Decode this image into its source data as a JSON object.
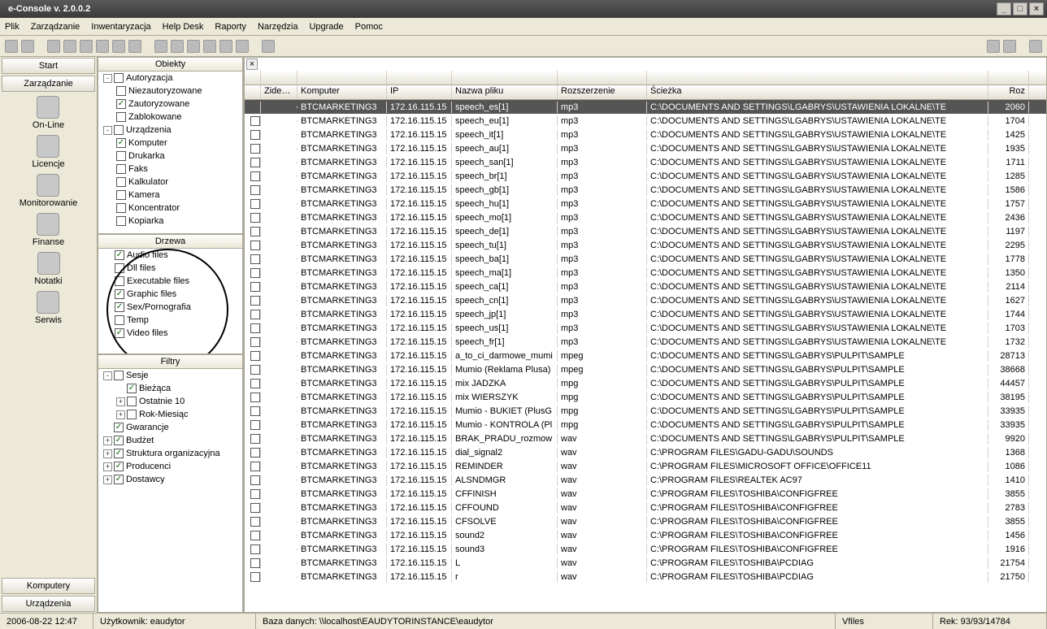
{
  "window": {
    "title": "e-Console v. 2.0.0.2"
  },
  "menu": [
    "Plik",
    "Zarządzanie",
    "Inwentaryzacja",
    "Help Desk",
    "Raporty",
    "Narzędzia",
    "Upgrade",
    "Pomoc"
  ],
  "leftnav": {
    "top_buttons": [
      "Start",
      "Zarządzanie"
    ],
    "items": [
      {
        "label": "On-Line"
      },
      {
        "label": "Licencje"
      },
      {
        "label": "Monitorowanie"
      },
      {
        "label": "Finanse"
      },
      {
        "label": "Notatki"
      },
      {
        "label": "Serwis"
      }
    ],
    "bottom_buttons": [
      "Komputery",
      "Urządzenia"
    ]
  },
  "panels": {
    "obiekty": {
      "title": "Obiekty",
      "tree": [
        {
          "indent": 0,
          "exp": "-",
          "chk": false,
          "label": "Autoryzacja"
        },
        {
          "indent": 1,
          "chk": false,
          "label": "Niezautoryzowane"
        },
        {
          "indent": 1,
          "chk": true,
          "label": "Zautoryzowane"
        },
        {
          "indent": 1,
          "chk": false,
          "label": "Zablokowane"
        },
        {
          "indent": 0,
          "exp": "-",
          "chk": false,
          "label": "Urządzenia"
        },
        {
          "indent": 1,
          "chk": true,
          "label": "Komputer"
        },
        {
          "indent": 1,
          "chk": false,
          "label": "Drukarka"
        },
        {
          "indent": 1,
          "chk": false,
          "label": "Faks"
        },
        {
          "indent": 1,
          "chk": false,
          "label": "Kalkulator"
        },
        {
          "indent": 1,
          "chk": false,
          "label": "Kamera"
        },
        {
          "indent": 1,
          "chk": false,
          "label": "Koncentrator"
        },
        {
          "indent": 1,
          "chk": false,
          "label": "Kopiarka"
        }
      ]
    },
    "drzewa": {
      "title": "Drzewa",
      "items": [
        {
          "chk": true,
          "label": "Audio files"
        },
        {
          "chk": false,
          "label": "Dll files"
        },
        {
          "chk": false,
          "label": "Executable files"
        },
        {
          "chk": true,
          "label": "Graphic files"
        },
        {
          "chk": true,
          "label": "Sex/Pornografia"
        },
        {
          "chk": false,
          "label": "Temp"
        },
        {
          "chk": true,
          "label": "Video files"
        }
      ]
    },
    "filtry": {
      "title": "Filtry",
      "tree": [
        {
          "indent": 0,
          "exp": "-",
          "chk": false,
          "label": "Sesje"
        },
        {
          "indent": 1,
          "exp": "",
          "chk": true,
          "label": "Bieżąca"
        },
        {
          "indent": 1,
          "exp": "+",
          "chk": false,
          "label": "Ostatnie 10"
        },
        {
          "indent": 1,
          "exp": "+",
          "chk": false,
          "label": "Rok-Miesiąc"
        },
        {
          "indent": 0,
          "exp": "",
          "chk": true,
          "label": "Gwarancje"
        },
        {
          "indent": 0,
          "exp": "+",
          "chk": true,
          "label": "Budżet"
        },
        {
          "indent": 0,
          "exp": "+",
          "chk": true,
          "label": "Struktura organizacyjna"
        },
        {
          "indent": 0,
          "exp": "+",
          "chk": true,
          "label": "Producenci"
        },
        {
          "indent": 0,
          "exp": "+",
          "chk": true,
          "label": "Dostawcy"
        }
      ]
    }
  },
  "grid": {
    "columns": [
      "",
      "Zidentyf",
      "Komputer",
      "IP",
      "Nazwa pliku",
      "Rozszerzenie",
      "Ścieżka",
      "Roz"
    ],
    "path1": "C:\\DOCUMENTS AND SETTINGS\\LGABRYS\\USTAWIENIA LOKALNE\\TE",
    "path2": "C:\\DOCUMENTS AND SETTINGS\\LGABRYS\\PULPIT\\SAMPLE",
    "rows": [
      {
        "sel": true,
        "name": "speech_es[1]",
        "ext": "mp3",
        "p": 1,
        "size": "2060"
      },
      {
        "name": "speech_eu[1]",
        "ext": "mp3",
        "p": 1,
        "size": "1704"
      },
      {
        "name": "speech_it[1]",
        "ext": "mp3",
        "p": 1,
        "size": "1425"
      },
      {
        "name": "speech_au[1]",
        "ext": "mp3",
        "p": 1,
        "size": "1935"
      },
      {
        "name": "speech_san[1]",
        "ext": "mp3",
        "p": 1,
        "size": "1711"
      },
      {
        "name": "speech_br[1]",
        "ext": "mp3",
        "p": 1,
        "size": "1285"
      },
      {
        "name": "speech_gb[1]",
        "ext": "mp3",
        "p": 1,
        "size": "1586"
      },
      {
        "name": "speech_hu[1]",
        "ext": "mp3",
        "p": 1,
        "size": "1757"
      },
      {
        "name": "speech_mo[1]",
        "ext": "mp3",
        "p": 1,
        "size": "2436"
      },
      {
        "name": "speech_de[1]",
        "ext": "mp3",
        "p": 1,
        "size": "1197"
      },
      {
        "name": "speech_tu[1]",
        "ext": "mp3",
        "p": 1,
        "size": "2295"
      },
      {
        "name": "speech_ba[1]",
        "ext": "mp3",
        "p": 1,
        "size": "1778"
      },
      {
        "name": "speech_ma[1]",
        "ext": "mp3",
        "p": 1,
        "size": "1350"
      },
      {
        "name": "speech_ca[1]",
        "ext": "mp3",
        "p": 1,
        "size": "2114"
      },
      {
        "name": "speech_cn[1]",
        "ext": "mp3",
        "p": 1,
        "size": "1627"
      },
      {
        "name": "speech_jp[1]",
        "ext": "mp3",
        "p": 1,
        "size": "1744"
      },
      {
        "name": "speech_us[1]",
        "ext": "mp3",
        "p": 1,
        "size": "1703"
      },
      {
        "name": "speech_fr[1]",
        "ext": "mp3",
        "p": 1,
        "size": "1732"
      },
      {
        "name": "a_to_ci_darmowe_mumi",
        "ext": "mpeg",
        "p": 2,
        "size": "28713"
      },
      {
        "name": "Mumio (Reklama Plusa)",
        "ext": "mpeg",
        "p": 2,
        "size": "38668"
      },
      {
        "name": "mix JADZKA",
        "ext": "mpg",
        "p": 2,
        "size": "44457"
      },
      {
        "name": "mix WIERSZYK",
        "ext": "mpg",
        "p": 2,
        "size": "38195"
      },
      {
        "name": "Mumio - BUKIET (PlusG",
        "ext": "mpg",
        "p": 2,
        "size": "33935"
      },
      {
        "name": "Mumio - KONTROLA (Pl",
        "ext": "mpg",
        "p": 2,
        "size": "33935"
      },
      {
        "name": "BRAK_PRADU_rozmow",
        "ext": "wav",
        "p": 2,
        "size": "9920"
      },
      {
        "name": "dial_signal2",
        "ext": "wav",
        "path": "C:\\PROGRAM FILES\\GADU-GADU\\SOUNDS",
        "size": "1368"
      },
      {
        "name": "REMINDER",
        "ext": "wav",
        "path": "C:\\PROGRAM FILES\\MICROSOFT OFFICE\\OFFICE11",
        "size": "1086"
      },
      {
        "name": "ALSNDMGR",
        "ext": "wav",
        "path": "C:\\PROGRAM FILES\\REALTEK AC97",
        "size": "1410"
      },
      {
        "name": "CFFINISH",
        "ext": "wav",
        "path": "C:\\PROGRAM FILES\\TOSHIBA\\CONFIGFREE",
        "size": "3855"
      },
      {
        "name": "CFFOUND",
        "ext": "wav",
        "path": "C:\\PROGRAM FILES\\TOSHIBA\\CONFIGFREE",
        "size": "2783"
      },
      {
        "name": "CFSOLVE",
        "ext": "wav",
        "path": "C:\\PROGRAM FILES\\TOSHIBA\\CONFIGFREE",
        "size": "3855"
      },
      {
        "name": "sound2",
        "ext": "wav",
        "path": "C:\\PROGRAM FILES\\TOSHIBA\\CONFIGFREE",
        "size": "1456"
      },
      {
        "name": "sound3",
        "ext": "wav",
        "path": "C:\\PROGRAM FILES\\TOSHIBA\\CONFIGFREE",
        "size": "1916"
      },
      {
        "name": "L",
        "ext": "wav",
        "path": "C:\\PROGRAM FILES\\TOSHIBA\\PCDIAG",
        "size": "21754"
      },
      {
        "name": "r",
        "ext": "wav",
        "path": "C:\\PROGRAM FILES\\TOSHIBA\\PCDIAG",
        "size": "21750"
      }
    ],
    "computer": "BTCMARKETING3",
    "ip": "172.16.115.15"
  },
  "status": {
    "datetime": "2006-08-22  12:47",
    "user": "Użytkownik: eaudytor",
    "db": "Baza danych: \\\\localhost\\EAUDYTORINSTANCE\\eaudytor",
    "vfiles": "Vfiles",
    "rek": "Rek: 93/93/14784"
  }
}
